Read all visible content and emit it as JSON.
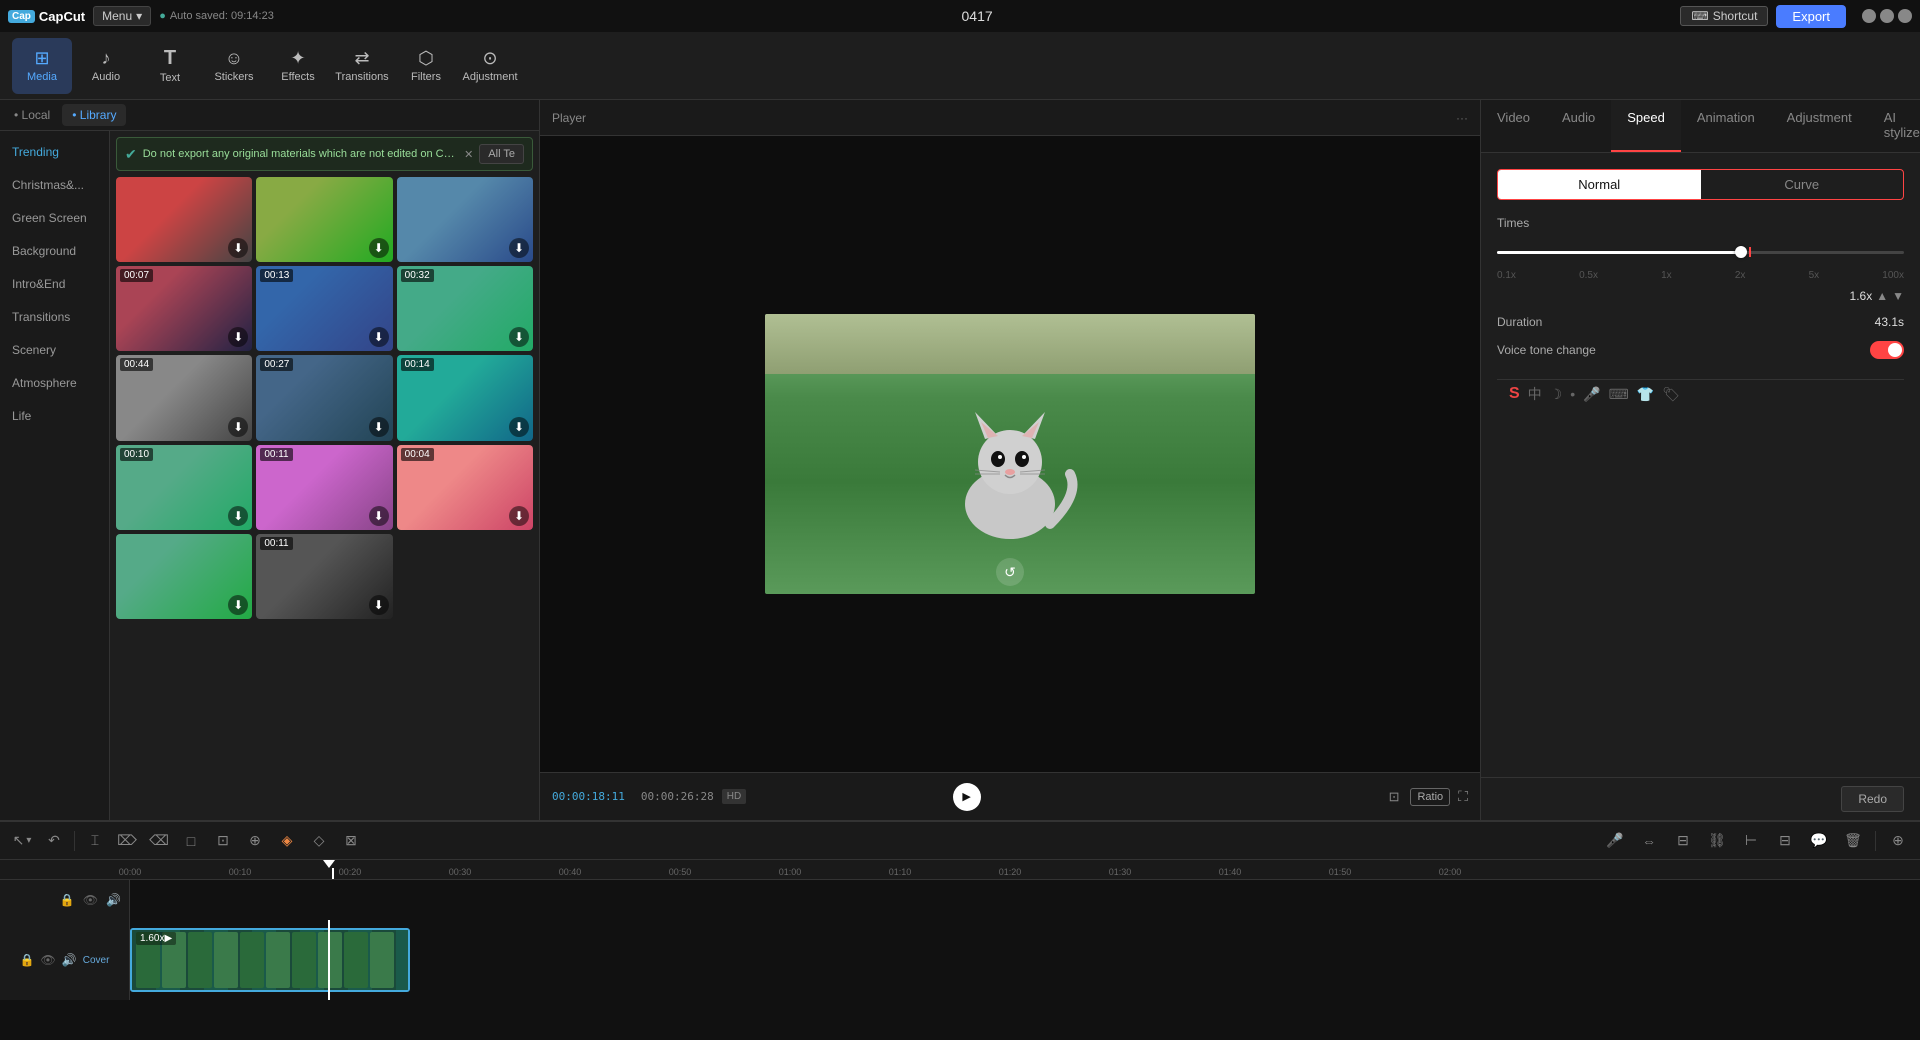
{
  "app": {
    "logo": "CapCut",
    "menu_label": "Menu",
    "menu_arrow": "▾",
    "auto_save": "Auto saved: 09:14:23",
    "title": "0417",
    "shortcut_label": "Shortcut",
    "export_label": "Export"
  },
  "toolbar": {
    "items": [
      {
        "id": "media",
        "icon": "⊞",
        "label": "Media",
        "active": true
      },
      {
        "id": "audio",
        "icon": "♪",
        "label": "Audio",
        "active": false
      },
      {
        "id": "text",
        "icon": "T",
        "label": "Text",
        "active": false
      },
      {
        "id": "stickers",
        "icon": "☺",
        "label": "Stickers",
        "active": false
      },
      {
        "id": "effects",
        "icon": "✦",
        "label": "Effects",
        "active": false
      },
      {
        "id": "transitions",
        "icon": "⇄",
        "label": "Transitions",
        "active": false
      },
      {
        "id": "filters",
        "icon": "⬡",
        "label": "Filters",
        "active": false
      },
      {
        "id": "adjustment",
        "icon": "⊙",
        "label": "Adjustment",
        "active": false
      }
    ]
  },
  "left_panel": {
    "tabs": [
      {
        "id": "local",
        "label": "Local"
      },
      {
        "id": "library",
        "label": "Library",
        "active": true
      }
    ],
    "nav_items": [
      {
        "id": "trending",
        "label": "Trending",
        "active": true
      },
      {
        "id": "christmas",
        "label": "Christmas&..."
      },
      {
        "id": "green-screen",
        "label": "Green Screen"
      },
      {
        "id": "background",
        "label": "Background"
      },
      {
        "id": "intro-end",
        "label": "Intro&End"
      },
      {
        "id": "transitions",
        "label": "Transitions"
      },
      {
        "id": "scenery",
        "label": "Scenery"
      },
      {
        "id": "atmosphere",
        "label": "Atmosphere"
      },
      {
        "id": "life",
        "label": "Life"
      }
    ],
    "notification": "Do not export any original materials which are not edited on CapCut to avoi...",
    "all_te_label": "All Te",
    "media_items": [
      {
        "duration": "",
        "color_class": "thumb-color-1",
        "has_download": true,
        "row": 1
      },
      {
        "duration": "",
        "color_class": "thumb-color-2",
        "has_download": true,
        "row": 1
      },
      {
        "duration": "",
        "color_class": "thumb-color-3",
        "has_download": true,
        "row": 1
      },
      {
        "duration": "00:07",
        "color_class": "thumb-color-4",
        "has_download": true,
        "row": 2
      },
      {
        "duration": "00:13",
        "color_class": "thumb-color-5",
        "has_download": true,
        "row": 2
      },
      {
        "duration": "00:32",
        "color_class": "thumb-color-6",
        "has_download": true,
        "row": 2
      },
      {
        "duration": "00:44",
        "color_class": "thumb-color-7",
        "has_download": true,
        "row": 3
      },
      {
        "duration": "00:27",
        "color_class": "thumb-color-8",
        "has_download": true,
        "row": 3
      },
      {
        "duration": "00:14",
        "color_class": "thumb-color-9",
        "has_download": true,
        "row": 3
      },
      {
        "duration": "00:10",
        "color_class": "thumb-color-10",
        "has_download": true,
        "row": 4
      },
      {
        "duration": "00:11",
        "color_class": "thumb-color-11",
        "has_download": true,
        "row": 4
      },
      {
        "duration": "00:04",
        "color_class": "thumb-color-12",
        "has_download": true,
        "row": 4
      }
    ]
  },
  "player": {
    "label": "Player",
    "current_time": "00:00:18:11",
    "total_time": "00:00:26:28",
    "quality": "HD",
    "ratio_label": "Ratio"
  },
  "right_panel": {
    "tabs": [
      {
        "id": "video",
        "label": "Video"
      },
      {
        "id": "audio",
        "label": "Audio"
      },
      {
        "id": "speed",
        "label": "Speed",
        "active": true
      },
      {
        "id": "animation",
        "label": "Animation"
      },
      {
        "id": "adjustment",
        "label": "Adjustment"
      },
      {
        "id": "ai-stylize",
        "label": "AI stylize"
      }
    ],
    "speed": {
      "mode_tabs": [
        {
          "id": "normal",
          "label": "Normal",
          "active": true
        },
        {
          "id": "curve",
          "label": "Curve"
        }
      ],
      "times_label": "Times",
      "speed_value": "1.6x",
      "duration_label": "Duration",
      "duration_value": "43.1s",
      "voice_tone_label": "Voice tone change"
    },
    "redo_label": "Redo"
  },
  "timeline": {
    "ruler_marks": [
      "00:00",
      "00:10",
      "00:20",
      "00:30",
      "00:40",
      "00:50",
      "01:00",
      "01:10",
      "01:20",
      "01:30",
      "01:40",
      "01:50",
      "02:00"
    ],
    "clip": {
      "label": "1.60x▶",
      "cover_label": "Cover"
    }
  }
}
